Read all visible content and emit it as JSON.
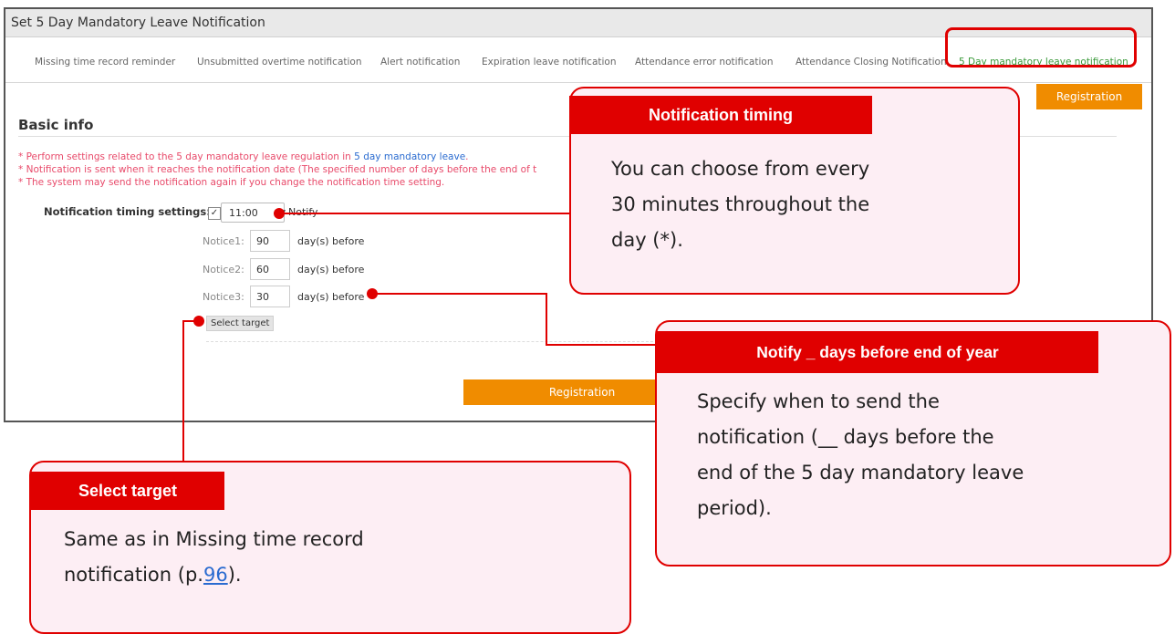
{
  "window": {
    "title": "Set 5 Day Mandatory Leave Notification"
  },
  "tabs": [
    {
      "label": "Missing time record reminder"
    },
    {
      "label": "Unsubmitted overtime notification"
    },
    {
      "label": "Alert notification"
    },
    {
      "label": "Expiration leave notification"
    },
    {
      "label": "Attendance error notification"
    },
    {
      "label": "Attendance Closing Notification"
    },
    {
      "label": "5 Day mandatory leave notification"
    }
  ],
  "buttons": {
    "registration_top": "Registration",
    "registration_bottom": "Registration",
    "select_target": "Select target"
  },
  "basic_info": {
    "title": "Basic info",
    "note1_prefix": "* Perform settings related to the 5 day mandatory leave regulation in ",
    "note1_link": "5 day mandatory leave",
    "note1_suffix": ".",
    "note2": "* Notification is sent when it reaches the notification date (The specified number of days before the end of t",
    "note3": "* The system may send the notification again if you change the notification time setting."
  },
  "form": {
    "timing_label": "Notification timing settings:",
    "checkbox_mark": "✓",
    "time_value": "11:00",
    "select_arrow": "▼",
    "notify_label": "Notify",
    "notices": [
      {
        "label": "Notice1:",
        "value": "90",
        "suffix": "day(s) before"
      },
      {
        "label": "Notice2:",
        "value": "60",
        "suffix": "day(s) before"
      },
      {
        "label": "Notice3:",
        "value": "30",
        "suffix": "day(s) before"
      }
    ]
  },
  "callouts": {
    "timing": {
      "head": "Notification timing",
      "lines": [
        "You can choose from every",
        "30 minutes throughout the",
        "day (*)."
      ]
    },
    "days": {
      "head": "Notify _ days before end of year",
      "lines": [
        "Specify when to send the",
        "notification (__ days before the",
        "end of the 5 day mandatory leave",
        "period)."
      ]
    },
    "target": {
      "head": "Select target",
      "line1": "Same as in Missing time record",
      "line2_prefix": "notification (p.",
      "line2_link": "96",
      "line2_suffix": ")."
    }
  },
  "colors": {
    "accent_red": "#e00000",
    "orange_button": "#f08c00",
    "active_tab": "#3a9a3a",
    "callout_bg": "#fdeef4"
  }
}
